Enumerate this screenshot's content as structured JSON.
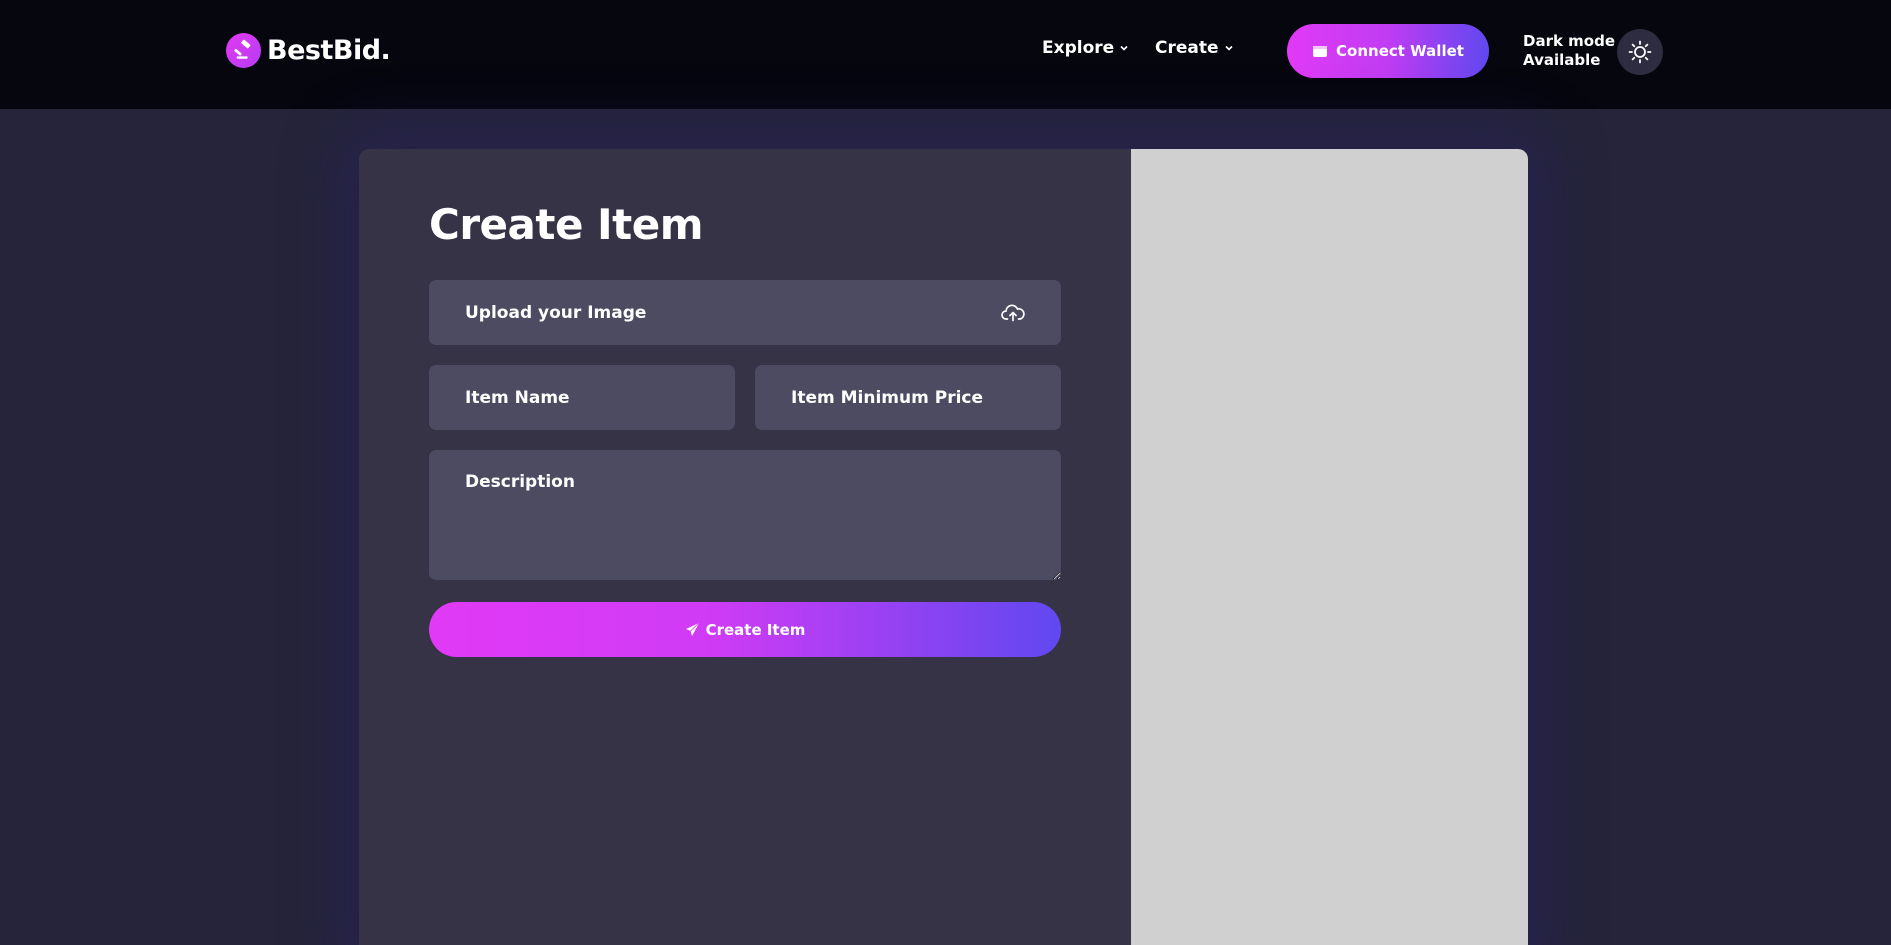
{
  "navbar": {
    "logo_text": "BestBid.",
    "explore_label": "Explore",
    "create_label": "Create",
    "connect_wallet_label": "Connect Wallet",
    "dark_mode_line1": "Dark mode",
    "dark_mode_line2": "Available"
  },
  "form": {
    "title": "Create Item",
    "upload_label": "Upload your Image",
    "item_name_placeholder": "Item Name",
    "item_price_placeholder": "Item Minimum Price",
    "description_placeholder": "Description",
    "submit_label": "Create Item"
  },
  "colors": {
    "navbar_bg": "#06060f",
    "page_bg": "#25243a",
    "panel_bg": "#353345",
    "field_bg": "#4c4b61",
    "preview_bg": "#d0d0d0",
    "accent_start": "#e13af6",
    "accent_end": "#6048f0"
  },
  "icons": {
    "logo": "gavel-icon",
    "wallet": "wallet-icon",
    "theme": "sun-icon",
    "upload": "cloud-upload-icon",
    "submit": "paper-plane-icon"
  }
}
